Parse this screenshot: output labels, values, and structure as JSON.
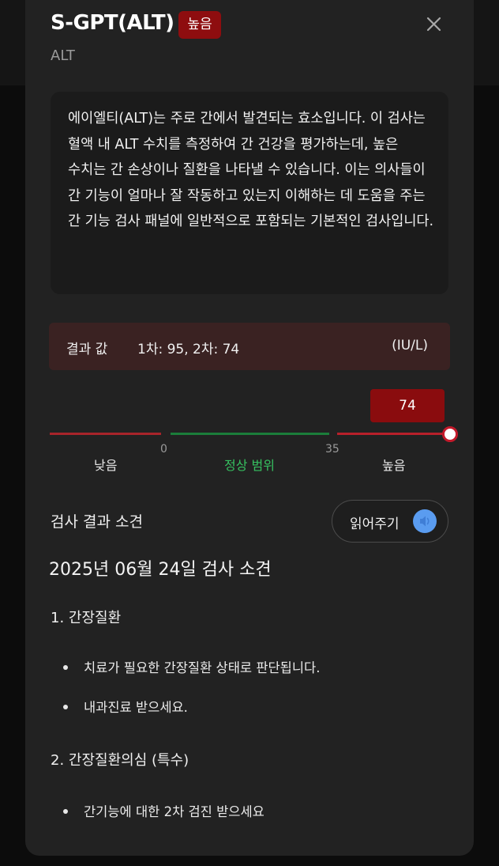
{
  "header": {
    "title": "S-GPT(ALT)",
    "level_badge": "높음",
    "subtitle": "ALT"
  },
  "description": "에이엘티(ALT)는 주로 간에서 발견되는 효소입니다. 이 검사는 혈액 내 ALT 수치를 측정하여 간 건강을 평가하는데, 높은 수치는 간 손상이나 질환을 나타낼 수 있습니다. 이는 의사들이 간 기능이 얼마나 잘 작동하고 있는지 이해하는 데 도움을 주는 간 기능 검사 패널에 일반적으로 포함되는 기본적인 검사입니다.",
  "result": {
    "label": "결과 값",
    "value": "1차: 95, 2차: 74",
    "unit": "(IU/L)"
  },
  "gauge": {
    "current_value": "74",
    "min_tick": "0",
    "max_tick": "35",
    "low_label": "낮음",
    "normal_label": "정상 범위",
    "high_label": "높음",
    "colors": {
      "low": "#a8242a",
      "normal": "#1b7d3a",
      "high": "#b8202a",
      "normal_text": "#36c060"
    }
  },
  "opinion": {
    "section_title": "검사 결과 소견",
    "read_button_label": "읽어주기",
    "report_title": "2025년 06월 24일 검사 소견",
    "findings": [
      {
        "heading": "1. 간장질환",
        "items": [
          "치료가 필요한 간장질환 상태로 판단됩니다.",
          "내과진료 받으세요."
        ]
      },
      {
        "heading": "2. 간장질환의심 (특수)",
        "items": [
          "간기능에 대한 2차 검진 받으세요"
        ]
      }
    ]
  },
  "icons": {
    "close": "close-icon",
    "speaker": "speaker-icon"
  }
}
